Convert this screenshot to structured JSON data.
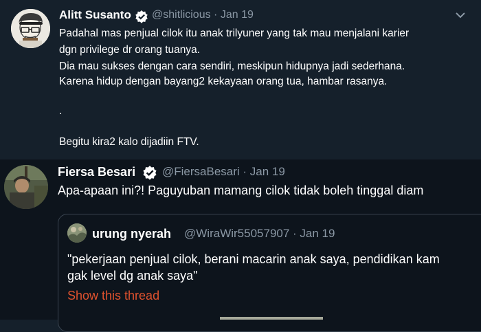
{
  "tweets": [
    {
      "name": "Alitt Susanto",
      "handle": "@shitlicious · Jan 19",
      "lines": [
        "Padahal mas penjual cilok itu anak trilyuner yang tak mau menjalani karier",
        "dgn privilege dr orang tuanya.",
        "Dia mau sukses dengan cara sendiri, meskipun hidupnya jadi sederhana.",
        "Karena hidup dengan bayang2 kekayaan orang tua, hambar rasanya.",
        ".",
        "Begitu kira2 kalo dijadiin FTV."
      ]
    },
    {
      "name": "Fiersa Besari",
      "handle": "@FiersaBesari · Jan 19",
      "text": "Apa-apaan ini?! Paguyuban mamang cilok tidak boleh tinggal diam",
      "quote": {
        "name": "urung nyerah",
        "handle": "@WiraWir55057907 · Jan 19",
        "lines": [
          "\"pekerjaan penjual cilok, berani macarin anak saya, pendidikan kam",
          "gak level dg anak saya\""
        ],
        "show_thread": "Show this thread"
      }
    }
  ],
  "colors": {
    "background": "#15202b",
    "accent_link": "#e0522e",
    "verified": "#ffffff",
    "muted": "#8b98a5"
  },
  "icons": [
    "verified-badge-icon",
    "chevron-down-icon"
  ]
}
